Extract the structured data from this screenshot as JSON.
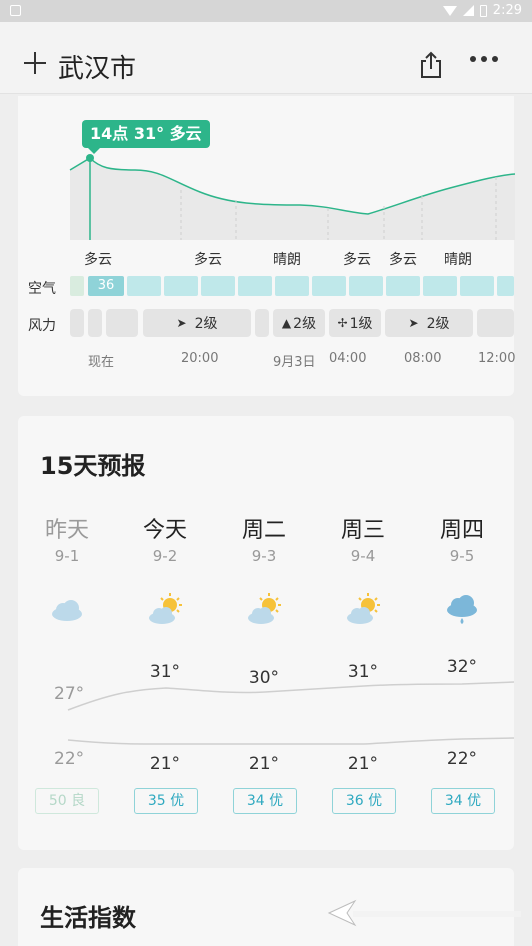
{
  "status_bar": {
    "time": "2:29"
  },
  "header": {
    "city": "武汉市"
  },
  "hourly": {
    "tooltip": "14点 31° 多云",
    "conditions": [
      "多云",
      "多云",
      "晴朗",
      "多云",
      "多云",
      "晴朗"
    ],
    "air_label": "空气",
    "air_first_value": "36",
    "wind_label": "风力",
    "wind_levels": [
      "2级",
      "2级",
      "1级",
      "2级"
    ],
    "times": [
      "现在",
      "20:00",
      "9月3日",
      "04:00",
      "08:00",
      "12:00"
    ],
    "colors": {
      "line": "#2db58a",
      "air": "#bfe8ea"
    }
  },
  "forecast": {
    "title": "15天预报",
    "days": [
      {
        "name": "昨天",
        "date": "9-1",
        "icon": "cloudy-icon",
        "high": "27°",
        "low": "22°",
        "aqi": "50 良"
      },
      {
        "name": "今天",
        "date": "9-2",
        "icon": "partly-cloudy-icon",
        "high": "31°",
        "low": "21°",
        "aqi": "35 优"
      },
      {
        "name": "周二",
        "date": "9-3",
        "icon": "partly-cloudy-icon",
        "high": "30°",
        "low": "21°",
        "aqi": "34 优"
      },
      {
        "name": "周三",
        "date": "9-4",
        "icon": "partly-cloudy-icon",
        "high": "31°",
        "low": "21°",
        "aqi": "36 优"
      },
      {
        "name": "周四",
        "date": "9-5",
        "icon": "rain-icon",
        "high": "32°",
        "low": "22°",
        "aqi": "34 优"
      }
    ]
  },
  "life": {
    "title": "生活指数"
  }
}
